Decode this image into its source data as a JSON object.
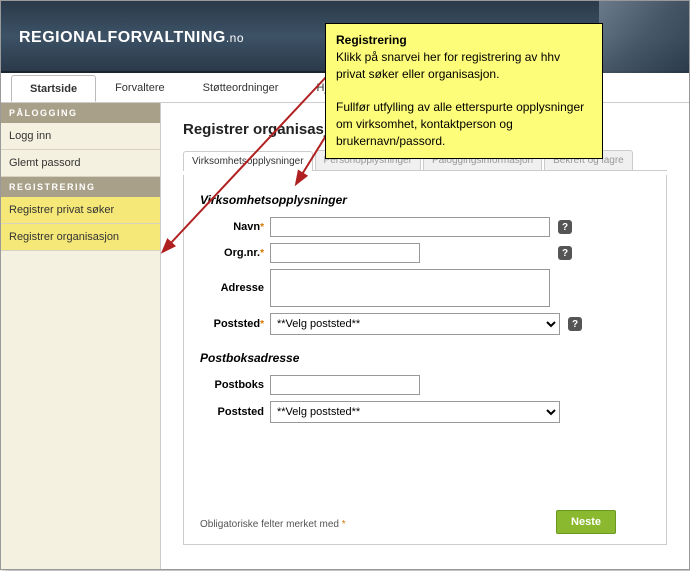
{
  "logo": {
    "main": "REGIONALFORVALTNING",
    "suffix": ".no"
  },
  "nav": {
    "tabs": [
      "Startside",
      "Forvaltere",
      "Støtteordninger",
      "Hje"
    ],
    "active": 0
  },
  "sidebar": {
    "sections": [
      {
        "title": "PÅLOGGING",
        "items": [
          {
            "label": "Logg inn",
            "highlight": false
          },
          {
            "label": "Glemt passord",
            "highlight": false
          }
        ]
      },
      {
        "title": "REGISTRERING",
        "items": [
          {
            "label": "Registrer privat søker",
            "highlight": true
          },
          {
            "label": "Registrer organisasjon",
            "highlight": true
          }
        ]
      }
    ]
  },
  "main": {
    "heading": "Registrer organisasjon",
    "tabs": [
      "Virksomhetsopplysninger",
      "Personopplysninger",
      "Påloggingsinformasjon",
      "Bekreft og lagre"
    ],
    "active_tab": 0,
    "section1_title": "Virksomhetsopplysninger",
    "section2_title": "Postboksadresse",
    "fields": {
      "navn_label": "Navn",
      "orgnr_label": "Org.nr.",
      "adresse_label": "Adresse",
      "poststed_label": "Poststed",
      "postboks_label": "Postboks",
      "poststed2_label": "Poststed",
      "select_placeholder": "**Velg poststed**"
    },
    "footer_note": "Obligatoriske felter merket med",
    "next_button": "Neste"
  },
  "callout": {
    "title": "Registrering",
    "p1": "Klikk på snarvei her for registrering av hhv privat søker eller organisasjon.",
    "p2": "Fullfør utfylling av alle etterspurte opplysninger om virksomhet, kontaktperson og brukernavn/passord."
  }
}
